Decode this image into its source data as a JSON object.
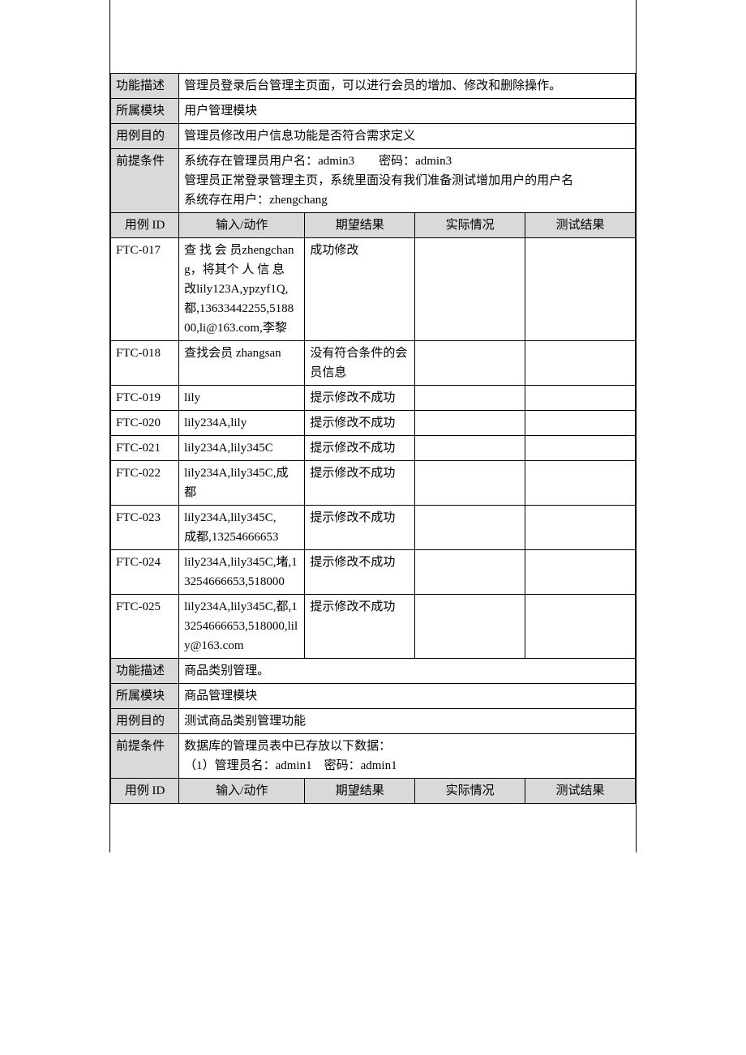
{
  "block1": {
    "labels": {
      "funcdesc": "功能描述",
      "module": "所属模块",
      "purpose": "用例目的",
      "precond": "前提条件"
    },
    "values": {
      "funcdesc": "管理员登录后台管理主页面，可以进行会员的增加、修改和删除操作。",
      "module": "用户管理模块",
      "purpose": "管理员修改用户信息功能是否符合需求定义",
      "precond_l1": "系统存在管理员用户名：admin3　　密码：admin3",
      "precond_l2": "管理员正常登录管理主页，系统里面没有我们准备测试增加用户的用户名",
      "precond_l3": "系统存在用户：zhengchang"
    }
  },
  "columns": {
    "id": "用例 ID",
    "input": "输入/动作",
    "expect": "期望结果",
    "actual": "实际情况",
    "result": "测试结果"
  },
  "cases1": [
    {
      "id": "FTC-017",
      "input": "查 找 会 员zhengchang，将其个 人 信 息 改lily123A,ypzyf1Q,都,13633442255,518800,li@163.com,李黎",
      "expect": "成功修改",
      "actual": "",
      "result": ""
    },
    {
      "id": "FTC-018",
      "input": "查找会员 zhangsan",
      "expect": "没有符合条件的会员信息",
      "actual": "",
      "result": ""
    },
    {
      "id": "FTC-019",
      "input": "lily",
      "expect": "提示修改不成功",
      "actual": "",
      "result": ""
    },
    {
      "id": "FTC-020",
      "input": "lily234A,lily",
      "expect": "提示修改不成功",
      "actual": "",
      "result": ""
    },
    {
      "id": "FTC-021",
      "input": "lily234A,lily345C",
      "expect": "提示修改不成功",
      "actual": "",
      "result": ""
    },
    {
      "id": "FTC-022",
      "input": "lily234A,lily345C,成都",
      "expect": "提示修改不成功",
      "actual": "",
      "result": ""
    },
    {
      "id": "FTC-023",
      "input": "lily234A,lily345C,　　　　　成都,13254666653",
      "expect": "提示修改不成功",
      "actual": "",
      "result": ""
    },
    {
      "id": "FTC-024",
      "input": "lily234A,lily345C,堵,13254666653,518000",
      "expect": "提示修改不成功",
      "actual": "",
      "result": ""
    },
    {
      "id": "FTC-025",
      "input": "lily234A,lily345C,都,13254666653,518000,lily@163.com",
      "expect": "提示修改不成功",
      "actual": "",
      "result": ""
    }
  ],
  "block2": {
    "labels": {
      "funcdesc": "功能描述",
      "module": "所属模块",
      "purpose": "用例目的",
      "precond": "前提条件"
    },
    "values": {
      "funcdesc": "商品类别管理。",
      "module": "商品管理模块",
      "purpose": "测试商品类别管理功能",
      "precond_l1": "数据库的管理员表中已存放以下数据：",
      "precond_l2": "（1）管理员名：admin1　密码：admin1"
    }
  }
}
